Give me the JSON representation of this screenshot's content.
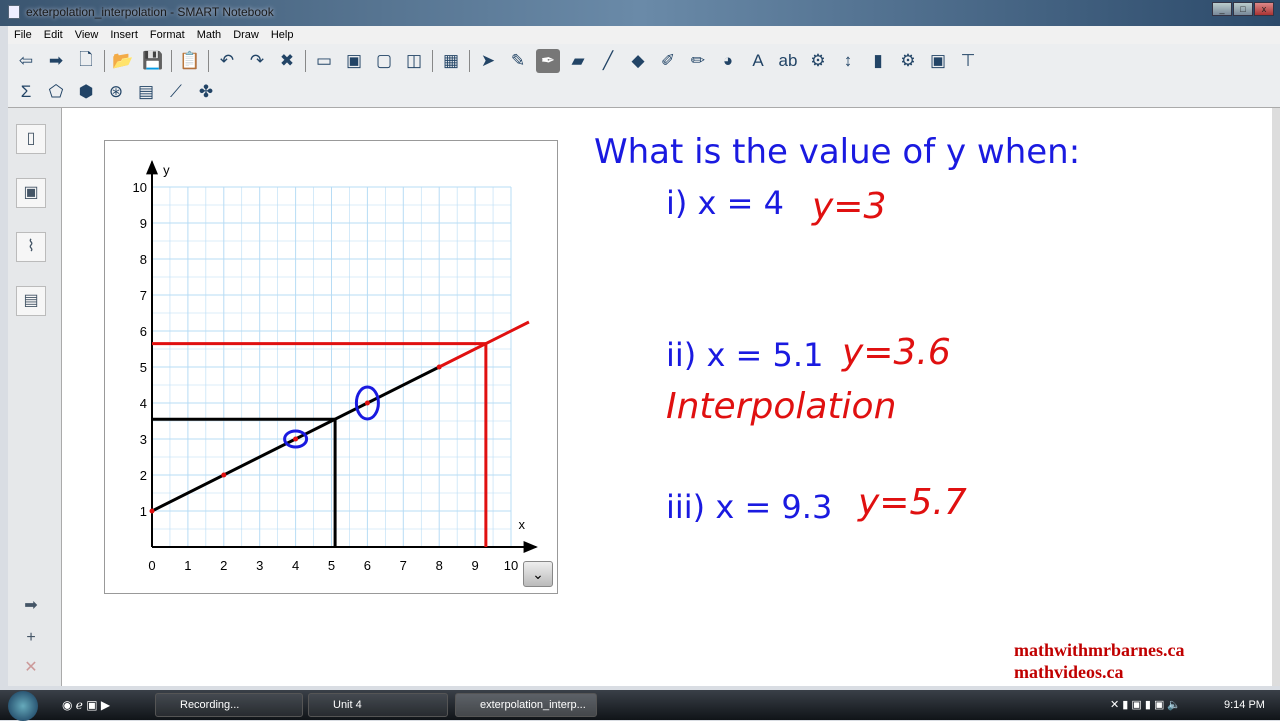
{
  "window": {
    "title": "exterpolation_interpolation - SMART Notebook"
  },
  "menu": [
    "File",
    "Edit",
    "View",
    "Insert",
    "Format",
    "Math",
    "Draw",
    "Help"
  ],
  "toolbar": {
    "row1": [
      "back-icon",
      "forward-icon",
      "add-page-icon",
      "|",
      "open-icon",
      "save-icon",
      "|",
      "paste-icon",
      "|",
      "undo-icon",
      "redo-icon",
      "delete-icon",
      "|",
      "screen-shade-icon",
      "full-screen-icon",
      "transparent-icon",
      "dual-page-icon",
      "|",
      "table-icon",
      "|",
      "select-icon",
      "creative-pen-icon",
      "pen-icon",
      "eraser-icon",
      "line-icon",
      "shapes-icon",
      "magic-pen-icon",
      "highlighter-icon",
      "fill-icon",
      "text-icon",
      "ab-icon",
      "properties-icon",
      "move-toolbar-icon",
      "bucket-icon",
      "gear-icon",
      "capture-icon",
      "pin-icon"
    ],
    "row2": [
      "sigma-icon",
      "polygon-icon",
      "3d-shape-icon",
      "compass-icon",
      "table-sum-icon",
      "graph-icon",
      "puzzle-icon"
    ],
    "selected": "pen-icon"
  },
  "graph": {
    "x_label": "x",
    "y_label": "y",
    "x_ticks": [
      "0",
      "1",
      "2",
      "3",
      "4",
      "5",
      "6",
      "7",
      "8",
      "9",
      "10"
    ],
    "y_ticks": [
      "1",
      "2",
      "3",
      "4",
      "5",
      "6",
      "7",
      "8",
      "9",
      "10"
    ],
    "line_points": [
      [
        0,
        1
      ],
      [
        2,
        2
      ],
      [
        4,
        3
      ],
      [
        6,
        4
      ],
      [
        8,
        5
      ]
    ],
    "extension_to": [
      10.5,
      6.25
    ],
    "circled_points": [
      [
        4,
        3
      ],
      [
        6,
        4
      ]
    ],
    "interp_guide": [
      5.1,
      3.55
    ],
    "extrap_guide": [
      9.3,
      5.65
    ],
    "colors": {
      "line": "#000000",
      "extension": "#e01010",
      "circle": "#1a1ae0",
      "grid": "#b7dcf5"
    }
  },
  "question": {
    "prompt": "What is the value of y when:",
    "items": [
      {
        "q": "i) x = 4",
        "a": "y=3"
      },
      {
        "q": "ii) x = 5.1",
        "a": "y=3.6",
        "note": "Interpolation"
      },
      {
        "q": "iii) x = 9.3",
        "a": "y=5.7"
      }
    ]
  },
  "sites": [
    "mathwithmrbarnes.ca",
    "mathvideos.ca"
  ],
  "taskbar": {
    "tasks": [
      "Recording...",
      "Unit 4",
      "exterpolation_interp..."
    ],
    "clock": "9:14 PM"
  }
}
